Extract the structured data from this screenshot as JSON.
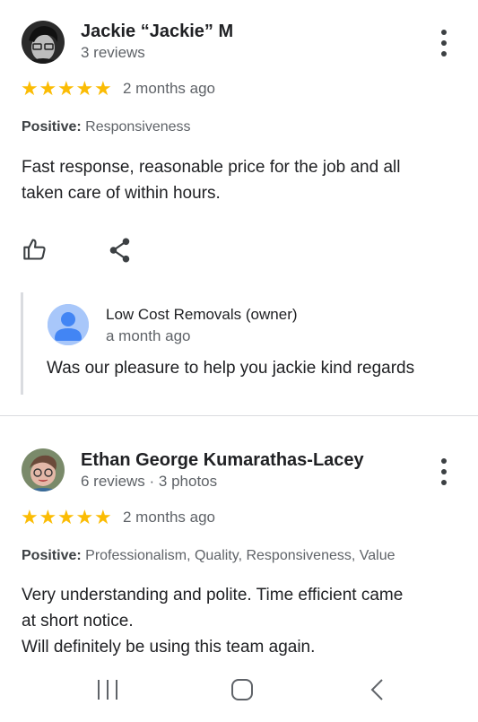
{
  "reviews": [
    {
      "name": "Jackie “Jackie” M",
      "meta": "3 reviews",
      "rating": 5,
      "time": "2 months ago",
      "positive_label": "Positive:",
      "positive_value": "Responsiveness",
      "text_line1": "Fast response, reasonable price for the job and all",
      "text_line2": "taken care of within hours.",
      "owner_reply": {
        "name": "Low Cost Removals (owner)",
        "time": "a month ago",
        "text": "Was our pleasure to help you jackie kind regards"
      }
    },
    {
      "name": "Ethan George Kumarathas-Lacey",
      "meta": "6 reviews · 3 photos",
      "rating": 5,
      "time": "2 months ago",
      "positive_label": "Positive:",
      "positive_value": "Professionalism, Quality, Responsiveness, Value",
      "text_line1": "Very understanding and polite. Time efficient came",
      "text_line2": "at short notice.",
      "text_line3": "Will definitely be using this team again."
    }
  ],
  "colors": {
    "star": "#fbbc04",
    "divider": "#dadce0",
    "muted": "#5f6368"
  },
  "icons": [
    "more-vert-icon",
    "thumbs-up-icon",
    "share-icon",
    "person-icon",
    "recents-icon",
    "home-icon",
    "back-icon"
  ]
}
